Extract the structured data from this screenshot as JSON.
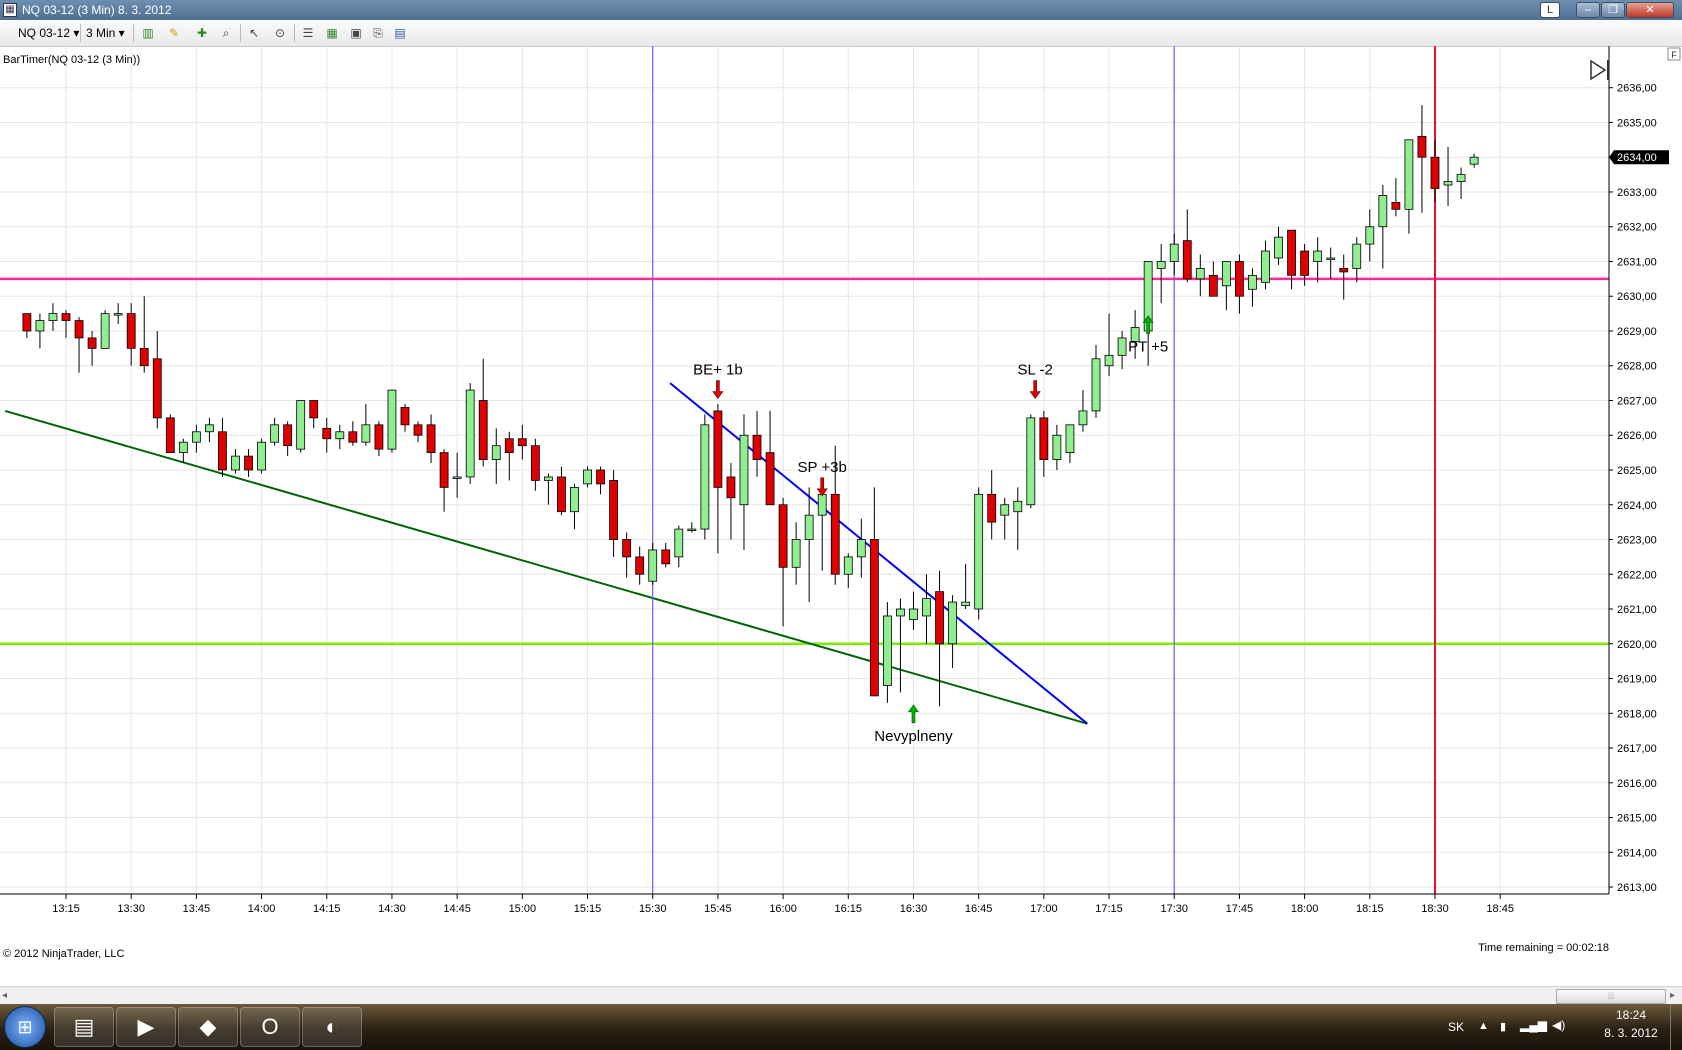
{
  "window": {
    "title": "NQ 03-12 (3 Min)  8. 3. 2012",
    "icon": "chart-window-icon",
    "extra_button": "L"
  },
  "toolbar": {
    "instrument": "NQ 03-12",
    "interval": "3 Min"
  },
  "indicator_label": "BarTimer(NQ 03-12 (3 Min))",
  "copyright": "© 2012 NinjaTrader, LLC",
  "time_remaining": "Time remaining = 00:02:18",
  "price_marker": "2634,00",
  "side_panel_tab": "F",
  "colors": {
    "up": "#90ee90",
    "down": "#e00000",
    "support": "#7ceb00",
    "resistance": "#ff2a9a",
    "trend_green": "#006400",
    "trend_blue": "#0000ff",
    "session": "#6060ff",
    "now": "#e8112d"
  },
  "chart_data": {
    "type": "candlestick",
    "title": "NQ 03-12 (3 Min)",
    "y_range": [
      2612.8,
      2637.2
    ],
    "y_ticks": [
      "2613,00",
      "2614,00",
      "2615,00",
      "2616,00",
      "2617,00",
      "2618,00",
      "2619,00",
      "2620,00",
      "2621,00",
      "2622,00",
      "2623,00",
      "2624,00",
      "2625,00",
      "2626,00",
      "2627,00",
      "2628,00",
      "2629,00",
      "2630,00",
      "2631,00",
      "2632,00",
      "2633,00",
      "2634,00",
      "2635,00",
      "2636,00"
    ],
    "x_ticks": [
      "13:15",
      "13:30",
      "13:45",
      "14:00",
      "14:15",
      "14:30",
      "14:45",
      "15:00",
      "15:15",
      "15:30",
      "15:45",
      "16:00",
      "16:15",
      "16:30",
      "16:45",
      "17:00",
      "17:15",
      "17:30",
      "17:45",
      "18:00",
      "18:15",
      "18:30",
      "18:45"
    ],
    "candles": [
      [
        "13:06",
        2629.5,
        2629.5,
        2628.8,
        2629.0
      ],
      [
        "13:09",
        2629.0,
        2629.5,
        2628.5,
        2629.3
      ],
      [
        "13:12",
        2629.3,
        2629.8,
        2629.0,
        2629.5
      ],
      [
        "13:15",
        2629.5,
        2629.6,
        2628.8,
        2629.3
      ],
      [
        "13:18",
        2629.3,
        2629.4,
        2627.8,
        2628.8
      ],
      [
        "13:21",
        2628.8,
        2629.0,
        2628.0,
        2628.5
      ],
      [
        "13:24",
        2628.5,
        2629.6,
        2628.5,
        2629.5
      ],
      [
        "13:27",
        2629.5,
        2629.8,
        2629.2,
        2629.5
      ],
      [
        "13:30",
        2629.5,
        2629.8,
        2628.0,
        2628.5
      ],
      [
        "13:33",
        2628.5,
        2630.0,
        2627.8,
        2628.0
      ],
      [
        "13:36",
        2628.2,
        2629.0,
        2626.2,
        2626.5
      ],
      [
        "13:39",
        2626.5,
        2626.6,
        2625.5,
        2625.5
      ],
      [
        "13:42",
        2625.5,
        2625.9,
        2625.2,
        2625.8
      ],
      [
        "13:45",
        2625.8,
        2626.3,
        2625.5,
        2626.1
      ],
      [
        "13:48",
        2626.1,
        2626.5,
        2625.8,
        2626.3
      ],
      [
        "13:51",
        2626.1,
        2626.5,
        2624.8,
        2625.0
      ],
      [
        "13:54",
        2625.0,
        2625.6,
        2624.9,
        2625.4
      ],
      [
        "13:57",
        2625.4,
        2625.6,
        2624.8,
        2625.0
      ],
      [
        "14:00",
        2625.0,
        2625.9,
        2624.9,
        2625.8
      ],
      [
        "14:03",
        2625.8,
        2626.5,
        2625.7,
        2626.3
      ],
      [
        "14:06",
        2626.3,
        2626.4,
        2625.4,
        2625.7
      ],
      [
        "14:09",
        2625.6,
        2627.0,
        2625.5,
        2627.0
      ],
      [
        "14:12",
        2627.0,
        2627.0,
        2626.2,
        2626.5
      ],
      [
        "14:15",
        2626.2,
        2626.5,
        2625.5,
        2625.9
      ],
      [
        "14:18",
        2625.9,
        2626.3,
        2625.6,
        2626.1
      ],
      [
        "14:21",
        2626.1,
        2626.4,
        2625.7,
        2625.8
      ],
      [
        "14:24",
        2625.8,
        2626.9,
        2625.7,
        2626.3
      ],
      [
        "14:27",
        2626.3,
        2626.4,
        2625.4,
        2625.6
      ],
      [
        "14:30",
        2625.6,
        2627.3,
        2625.5,
        2627.3
      ],
      [
        "14:33",
        2626.8,
        2626.9,
        2626.1,
        2626.3
      ],
      [
        "14:36",
        2626.3,
        2626.4,
        2625.8,
        2626.0
      ],
      [
        "14:39",
        2626.3,
        2626.6,
        2625.2,
        2625.5
      ],
      [
        "14:42",
        2625.5,
        2625.6,
        2623.8,
        2624.5
      ],
      [
        "14:45",
        2624.8,
        2625.5,
        2624.2,
        2624.8
      ],
      [
        "14:48",
        2624.8,
        2627.5,
        2624.6,
        2627.3
      ],
      [
        "14:51",
        2627.0,
        2628.2,
        2625.1,
        2625.3
      ],
      [
        "14:54",
        2625.3,
        2626.2,
        2624.6,
        2625.7
      ],
      [
        "14:57",
        2625.9,
        2626.1,
        2624.7,
        2625.5
      ],
      [
        "15:00",
        2625.9,
        2626.3,
        2625.3,
        2625.7
      ],
      [
        "15:03",
        2625.7,
        2625.9,
        2624.4,
        2624.7
      ],
      [
        "15:06",
        2624.7,
        2624.9,
        2624.0,
        2624.8
      ],
      [
        "15:09",
        2624.8,
        2625.1,
        2623.7,
        2623.8
      ],
      [
        "15:12",
        2623.8,
        2624.6,
        2623.3,
        2624.5
      ],
      [
        "15:15",
        2624.6,
        2625.1,
        2624.5,
        2625.0
      ],
      [
        "15:18",
        2625.0,
        2625.1,
        2624.3,
        2624.6
      ],
      [
        "15:21",
        2624.7,
        2625.0,
        2622.5,
        2623.0
      ],
      [
        "15:24",
        2623.0,
        2623.2,
        2621.9,
        2622.5
      ],
      [
        "15:27",
        2622.5,
        2622.8,
        2621.7,
        2622.0
      ],
      [
        "15:30",
        2621.8,
        2622.9,
        2621.7,
        2622.7
      ],
      [
        "15:33",
        2622.7,
        2622.9,
        2622.2,
        2622.3
      ],
      [
        "15:36",
        2622.5,
        2623.4,
        2622.2,
        2623.3
      ],
      [
        "15:39",
        2623.3,
        2623.5,
        2623.2,
        2623.3
      ],
      [
        "15:42",
        2623.3,
        2626.6,
        2623.0,
        2626.3
      ],
      [
        "15:45",
        2626.7,
        2626.9,
        2622.6,
        2624.5
      ],
      [
        "15:48",
        2624.8,
        2625.2,
        2623.0,
        2624.2
      ],
      [
        "15:51",
        2624.0,
        2626.6,
        2622.7,
        2626.0
      ],
      [
        "15:54",
        2626.0,
        2626.7,
        2624.8,
        2625.3
      ],
      [
        "15:57",
        2625.5,
        2626.7,
        2624.4,
        2624.0
      ],
      [
        "16:00",
        2624.0,
        2624.2,
        2620.5,
        2622.2
      ],
      [
        "16:03",
        2622.2,
        2623.5,
        2621.7,
        2623.0
      ],
      [
        "16:06",
        2623.0,
        2624.5,
        2621.2,
        2623.7
      ],
      [
        "16:09",
        2623.7,
        2624.7,
        2622.1,
        2624.3
      ],
      [
        "16:12",
        2624.3,
        2625.7,
        2621.7,
        2622.0
      ],
      [
        "16:15",
        2622.0,
        2622.6,
        2621.6,
        2622.5
      ],
      [
        "16:18",
        2622.5,
        2623.6,
        2621.9,
        2623.0
      ],
      [
        "16:21",
        2623.0,
        2624.5,
        2618.5,
        2618.5
      ],
      [
        "16:24",
        2618.8,
        2621.2,
        2618.3,
        2620.8
      ],
      [
        "16:27",
        2620.8,
        2621.3,
        2618.6,
        2621.0
      ],
      [
        "16:30",
        2620.7,
        2621.5,
        2620.4,
        2621.0
      ],
      [
        "16:33",
        2620.8,
        2622.0,
        2620.0,
        2621.3
      ],
      [
        "16:36",
        2621.5,
        2622.1,
        2618.2,
        2620.0
      ],
      [
        "16:39",
        2620.0,
        2621.4,
        2619.3,
        2621.2
      ],
      [
        "16:42",
        2621.1,
        2622.3,
        2621.0,
        2621.2
      ],
      [
        "16:45",
        2621.0,
        2624.5,
        2620.7,
        2624.3
      ],
      [
        "16:48",
        2624.3,
        2625.0,
        2623.0,
        2623.5
      ],
      [
        "16:51",
        2623.7,
        2624.2,
        2623.0,
        2624.0
      ],
      [
        "16:54",
        2623.8,
        2624.5,
        2622.7,
        2624.1
      ],
      [
        "16:57",
        2624.0,
        2626.6,
        2623.9,
        2626.5
      ],
      [
        "17:00",
        2626.5,
        2626.7,
        2624.8,
        2625.3
      ],
      [
        "17:03",
        2625.3,
        2626.3,
        2625.0,
        2626.0
      ],
      [
        "17:06",
        2625.5,
        2626.3,
        2625.2,
        2626.3
      ],
      [
        "17:09",
        2626.3,
        2627.3,
        2626.1,
        2626.7
      ],
      [
        "17:12",
        2626.7,
        2628.6,
        2626.5,
        2628.2
      ],
      [
        "17:15",
        2628.0,
        2629.5,
        2627.7,
        2628.3
      ],
      [
        "17:18",
        2628.3,
        2629.0,
        2627.9,
        2628.8
      ],
      [
        "17:21",
        2628.7,
        2629.6,
        2628.2,
        2629.1
      ],
      [
        "17:24",
        2629.0,
        2631.0,
        2628.0,
        2631.0
      ],
      [
        "17:27",
        2630.8,
        2631.5,
        2629.8,
        2631.0
      ],
      [
        "17:30",
        2631.0,
        2631.8,
        2630.6,
        2631.5
      ],
      [
        "17:33",
        2631.6,
        2632.5,
        2630.4,
        2630.5
      ],
      [
        "17:36",
        2630.5,
        2631.2,
        2630.0,
        2630.8
      ],
      [
        "17:39",
        2630.6,
        2631.0,
        2630.2,
        2630.0
      ],
      [
        "17:42",
        2630.3,
        2631.0,
        2629.6,
        2631.0
      ],
      [
        "17:45",
        2631.0,
        2631.2,
        2629.5,
        2630.0
      ],
      [
        "17:48",
        2630.2,
        2630.8,
        2629.7,
        2630.6
      ],
      [
        "17:51",
        2630.4,
        2631.6,
        2630.2,
        2631.3
      ],
      [
        "17:54",
        2631.1,
        2632.0,
        2630.9,
        2631.7
      ],
      [
        "17:57",
        2631.9,
        2631.9,
        2630.2,
        2630.6
      ],
      [
        "18:00",
        2631.3,
        2631.5,
        2630.3,
        2630.6
      ],
      [
        "18:03",
        2631.0,
        2631.7,
        2630.4,
        2631.3
      ],
      [
        "18:06",
        2631.1,
        2631.4,
        2630.5,
        2631.1
      ],
      [
        "18:09",
        2630.8,
        2631.2,
        2629.9,
        2630.7
      ],
      [
        "18:12",
        2630.8,
        2631.7,
        2630.4,
        2631.5
      ],
      [
        "18:15",
        2631.5,
        2632.5,
        2631.0,
        2632.0
      ],
      [
        "18:18",
        2632.0,
        2633.2,
        2630.8,
        2632.9
      ],
      [
        "18:21",
        2632.7,
        2633.4,
        2632.3,
        2632.5
      ],
      [
        "18:24",
        2632.5,
        2634.5,
        2631.8,
        2634.5
      ],
      [
        "18:27",
        2634.6,
        2635.5,
        2632.4,
        2634.0
      ],
      [
        "18:30",
        2634.0,
        2634.5,
        2632.7,
        2633.1
      ],
      [
        "18:33",
        2633.2,
        2634.3,
        2632.6,
        2633.3
      ],
      [
        "18:36",
        2633.3,
        2633.7,
        2632.8,
        2633.5
      ],
      [
        "18:39",
        2633.8,
        2634.1,
        2633.7,
        2634.0
      ]
    ],
    "lines": [
      {
        "name": "resistance",
        "type": "horizontal",
        "y": 2630.5
      },
      {
        "name": "support",
        "type": "horizontal",
        "y": 2620.0
      },
      {
        "name": "trend-green",
        "from": [
          "13:01",
          2626.7
        ],
        "to": [
          "17:10",
          2617.7
        ]
      },
      {
        "name": "trend-blue",
        "from": [
          "15:34",
          2627.5
        ],
        "to": [
          "17:10",
          2617.7
        ]
      },
      {
        "name": "session-start",
        "type": "vertical",
        "x": "15:30"
      },
      {
        "name": "session-end",
        "type": "vertical",
        "x": "17:30"
      },
      {
        "name": "now",
        "type": "vertical",
        "x": "18:30"
      }
    ],
    "annotations": [
      {
        "text": "BE+ 1b",
        "x": "15:45",
        "y": 2627.0,
        "arrow": "down",
        "color": "#e00000"
      },
      {
        "text": "SP +3b",
        "x": "16:09",
        "y": 2624.2,
        "arrow": "down",
        "color": "#e00000"
      },
      {
        "text": "Nevyplneny",
        "x": "16:30",
        "y": 2618.3,
        "arrow": "up",
        "color": "#00b000"
      },
      {
        "text": "SL -2",
        "x": "16:58",
        "y": 2627.0,
        "arrow": "down",
        "color": "#e00000"
      },
      {
        "text": "PT +5",
        "x": "17:24",
        "y": 2629.5,
        "arrow": "up",
        "color": "#00b000"
      }
    ]
  },
  "taskbar": {
    "apps": [
      {
        "icon": "explorer-icon",
        "glyph": "▤"
      },
      {
        "icon": "media-player-icon",
        "glyph": "▶"
      },
      {
        "icon": "book-icon",
        "glyph": "◆"
      },
      {
        "icon": "opera-icon",
        "glyph": "O"
      },
      {
        "icon": "ninjatrader-icon",
        "glyph": "◐"
      }
    ],
    "language": "SK",
    "time": "18:24",
    "date": "8. 3. 2012"
  }
}
